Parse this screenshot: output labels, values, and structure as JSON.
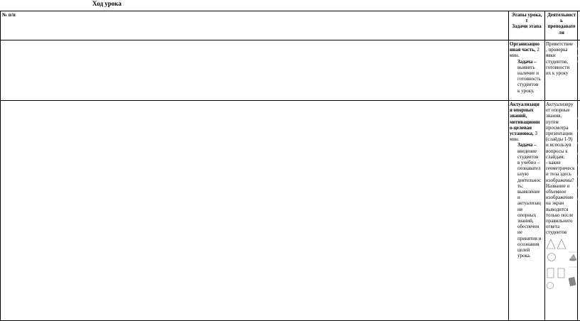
{
  "document": {
    "title": "Ход урока",
    "header": {
      "col_num": "№ п/п",
      "col_stages": [
        "Этапы урока,",
        "t",
        "Задачи этапа"
      ],
      "col_teacher": [
        "Деятельност",
        "ь",
        "преподавате",
        "ля"
      ]
    },
    "rows": [
      {
        "stage_title": [
          "Организацио",
          "нная часть,"
        ],
        "stage_time": "2 мин.",
        "task_label": "Задача –",
        "task_text": [
          "выявить",
          "наличие и",
          "готовность",
          "студентов",
          "к уроку."
        ],
        "teacher_text": [
          "Приветствие",
          ", проверка",
          "явки",
          "студентов,",
          "готовности",
          "их к уроку"
        ]
      },
      {
        "stage_title": [
          "Актуализаци",
          "я опорных",
          "знаний,",
          "мотивационн",
          "о-целевая",
          "установка,"
        ],
        "stage_time": "3 мин.",
        "task_label": "Задача –",
        "task_text": [
          "введение",
          "студентов",
          "в учебно –",
          "познавател",
          "ьную",
          "деятельнос",
          "ть;",
          "выявление",
          "и",
          "актуализац",
          "ия",
          "опорных",
          "знаний,",
          "обеспечен",
          "ие",
          "принятия и",
          "осознания",
          "целей",
          "урока."
        ],
        "teacher_text": [
          "Актуализиру",
          "ет опорные",
          "знания,",
          "путем",
          "просмотра",
          "презентации",
          "(слайды 1-9)",
          "и используя",
          "вопросы к",
          "слайдам:",
          "- какие",
          "геометрическ",
          "и тела здесь",
          "изображены?",
          "Название и",
          "объемное",
          "изображение",
          "на экран",
          "выводится",
          "только после",
          "правильного",
          "ответа",
          "студентов"
        ]
      }
    ],
    "icons": [
      "triangle-outline-icon",
      "cone-icon",
      "circle-outline-icon",
      "rectangle-outline-icon",
      "cylinder-icon"
    ]
  }
}
